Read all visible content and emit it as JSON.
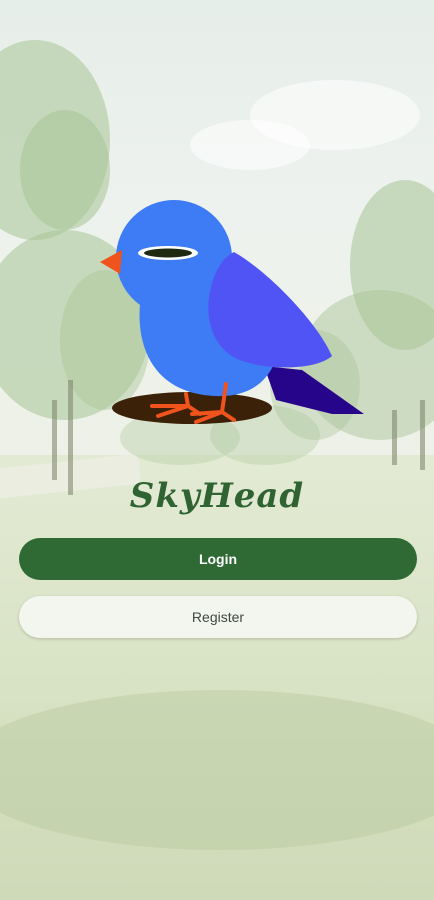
{
  "app": {
    "brand_name": "SkyHead"
  },
  "actions": {
    "login_label": "Login",
    "register_label": "Register"
  },
  "logo": {
    "icon": "bluebird-logo-icon"
  },
  "colors": {
    "primary": "#2f6a35",
    "brand_text": "#2f6432",
    "bird_body": "#3d7cf4",
    "bird_wing": "#5054f4",
    "bird_tail": "#27058a",
    "bird_beak": "#f0531c",
    "secondary_button": "#f3f5ef"
  }
}
